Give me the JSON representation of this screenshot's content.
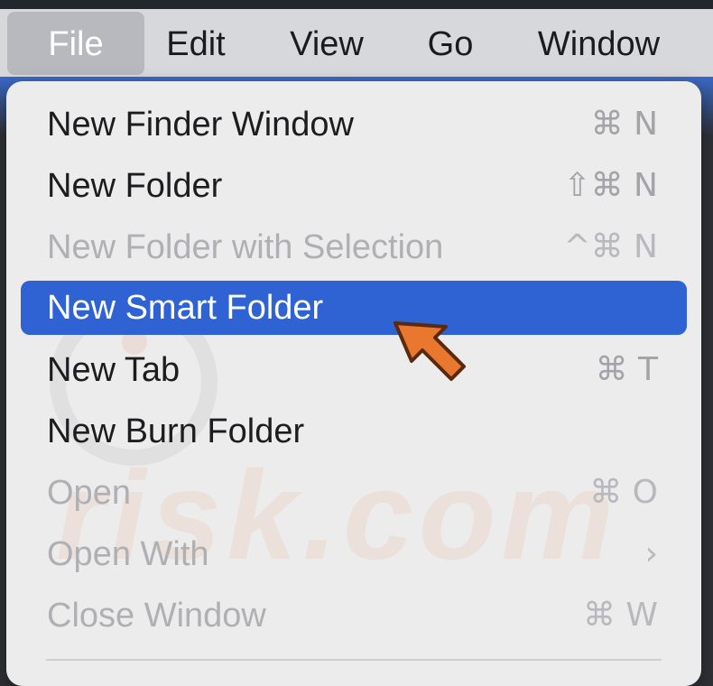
{
  "menubar": {
    "items": [
      {
        "label": "File",
        "active": true
      },
      {
        "label": "Edit",
        "active": false
      },
      {
        "label": "View",
        "active": false
      },
      {
        "label": "Go",
        "active": false
      },
      {
        "label": "Window",
        "active": false
      }
    ]
  },
  "file_menu": {
    "items": [
      {
        "label": "New Finder Window",
        "shortcut": "⌘ N",
        "enabled": true,
        "highlighted": false
      },
      {
        "label": "New Folder",
        "shortcut": "⇧⌘ N",
        "enabled": true,
        "highlighted": false
      },
      {
        "label": "New Folder with Selection",
        "shortcut": "^⌘ N",
        "enabled": false,
        "highlighted": false
      },
      {
        "label": "New Smart Folder",
        "shortcut": "",
        "enabled": true,
        "highlighted": true
      },
      {
        "label": "New Tab",
        "shortcut": "⌘ T",
        "enabled": true,
        "highlighted": false
      },
      {
        "label": "New Burn Folder",
        "shortcut": "",
        "enabled": true,
        "highlighted": false
      },
      {
        "label": "Open",
        "shortcut": "⌘ O",
        "enabled": false,
        "highlighted": false
      },
      {
        "label": "Open With",
        "shortcut": "›",
        "enabled": false,
        "highlighted": false
      },
      {
        "label": "Close Window",
        "shortcut": "⌘ W",
        "enabled": false,
        "highlighted": false
      }
    ]
  },
  "watermark": {
    "text": "risk.com"
  },
  "colors": {
    "highlight": "#2f63d3",
    "menu_background": "#ececed",
    "menubar_background": "#d7d8db",
    "cursor": "#e9782e"
  },
  "icons": {
    "pointer": "arrow-pointer-icon"
  }
}
